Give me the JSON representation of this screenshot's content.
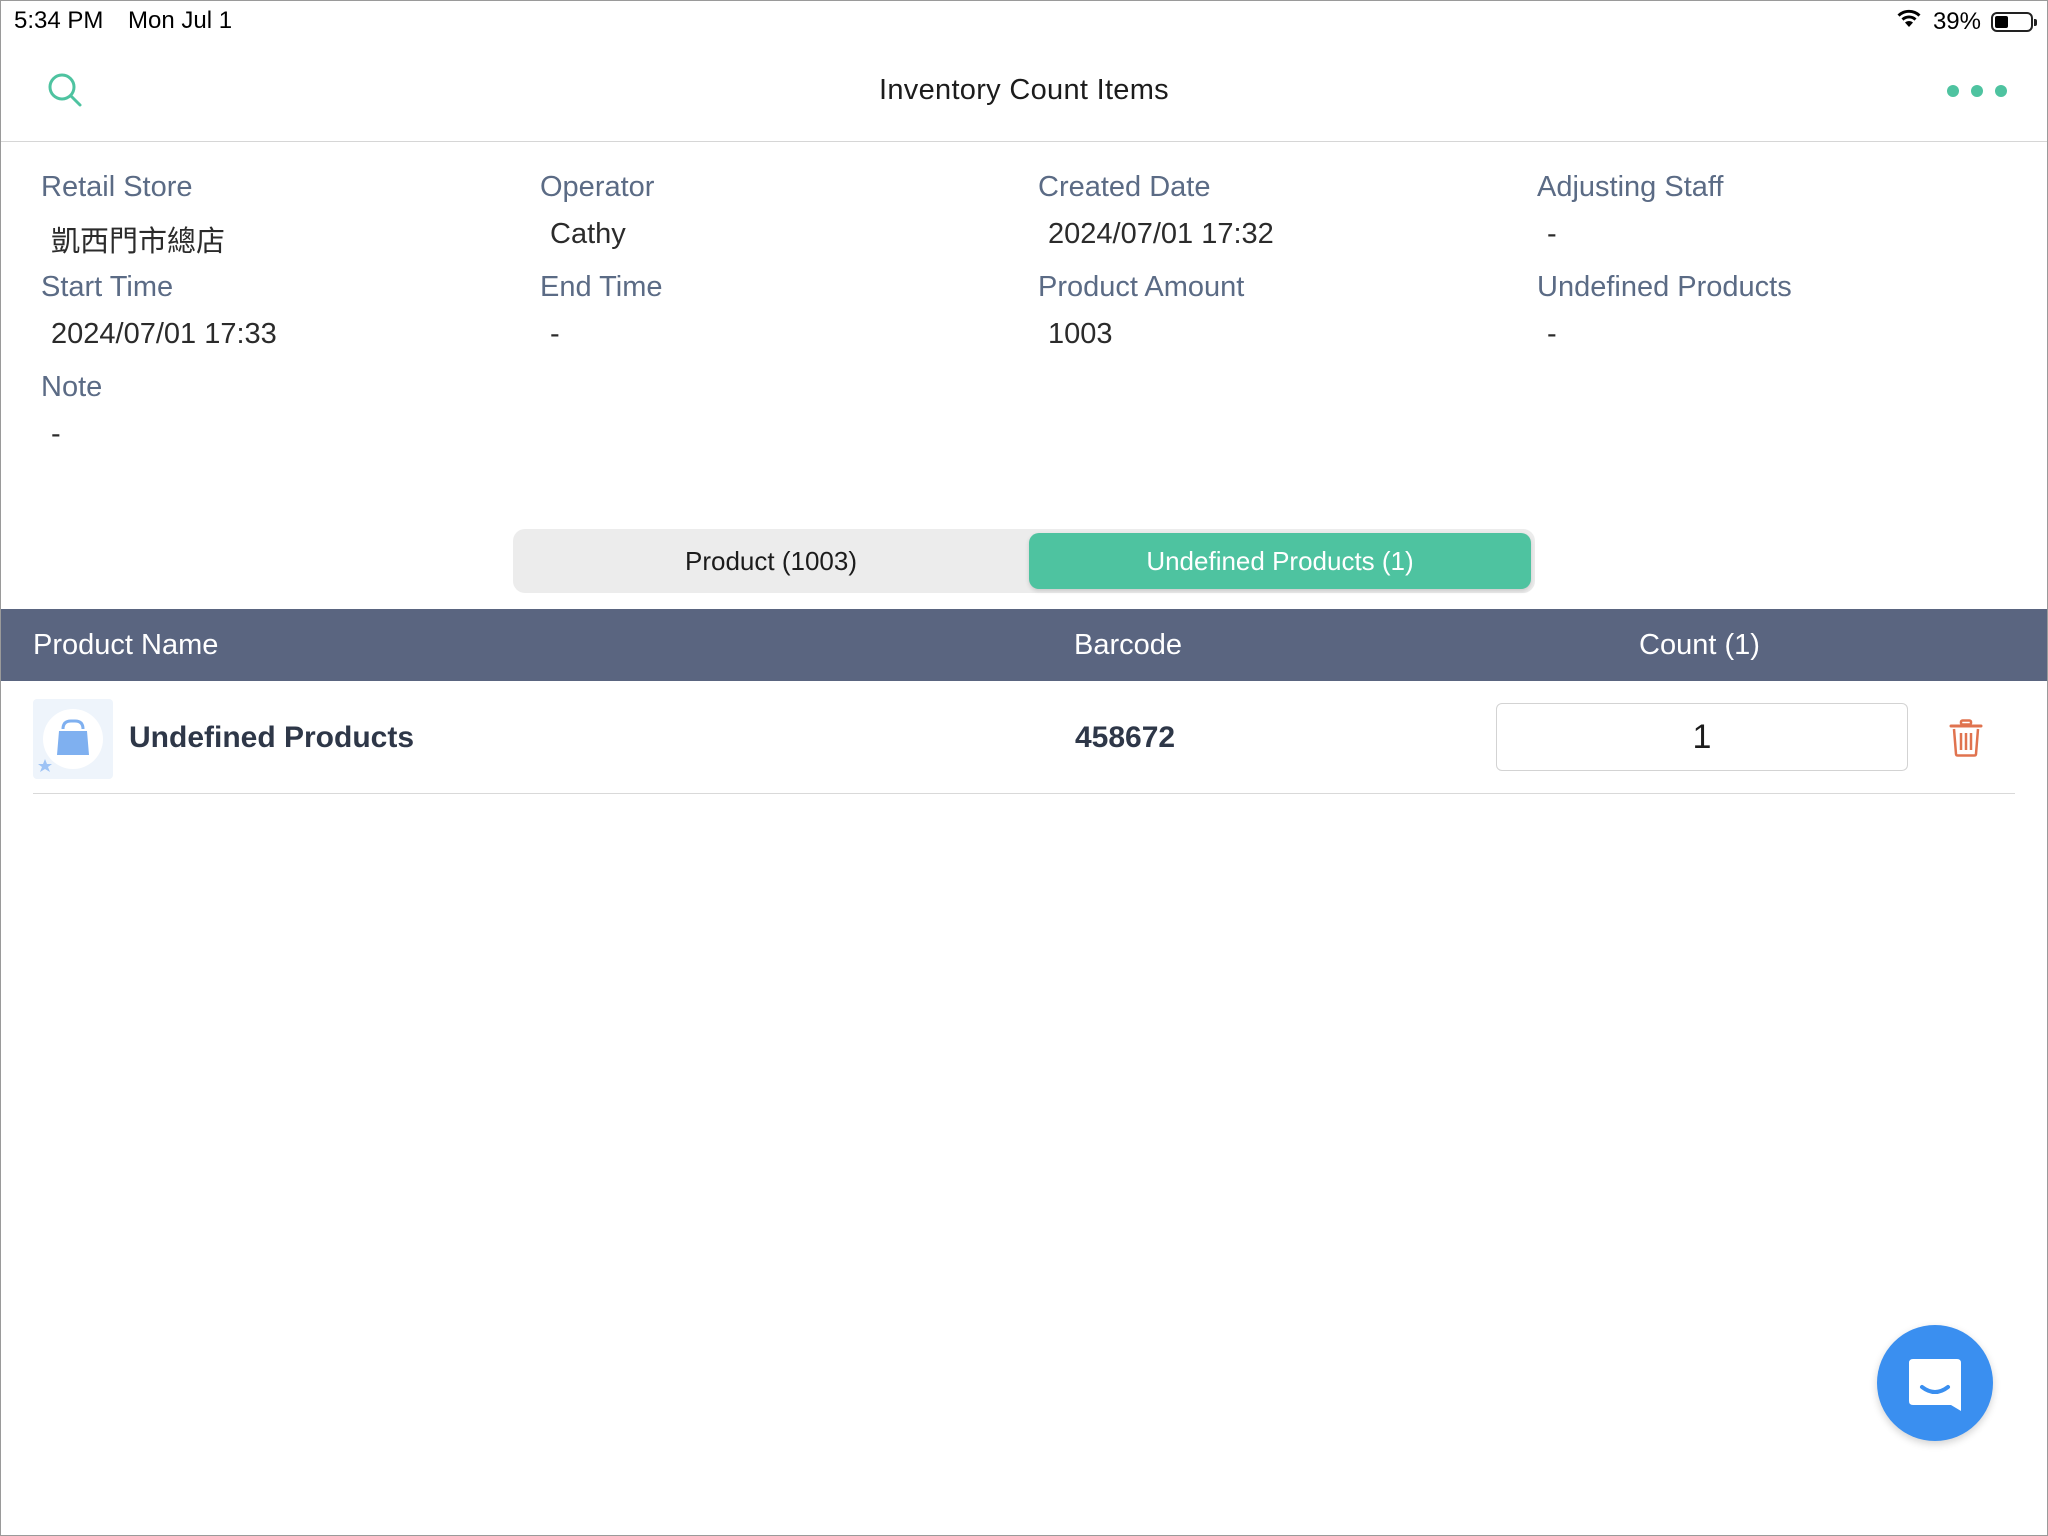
{
  "status_bar": {
    "time": "5:34 PM",
    "date": "Mon Jul 1",
    "battery": "39%",
    "battery_level": 0.39
  },
  "nav": {
    "title": "Inventory Count Items",
    "search_icon": "search-icon",
    "more_icon": "more-dots-icon"
  },
  "info": {
    "retail_store": {
      "label": "Retail Store",
      "value": "凱西門市總店"
    },
    "operator": {
      "label": "Operator",
      "value": "Cathy"
    },
    "created_date": {
      "label": "Created Date",
      "value": "2024/07/01 17:32"
    },
    "adjusting_staff": {
      "label": "Adjusting Staff",
      "value": "-"
    },
    "start_time": {
      "label": "Start Time",
      "value": "2024/07/01 17:33"
    },
    "end_time": {
      "label": "End Time",
      "value": "-"
    },
    "product_amount": {
      "label": "Product Amount",
      "value": "1003"
    },
    "undefined_products": {
      "label": "Undefined Products",
      "value": "-"
    },
    "note": {
      "label": "Note",
      "value": "-"
    }
  },
  "segments": {
    "product": "Product (1003)",
    "undefined": "Undefined Products (1)",
    "selected": "undefined"
  },
  "table": {
    "columns": {
      "name": "Product Name",
      "barcode": "Barcode",
      "count": "Count (1)"
    },
    "rows": [
      {
        "name": "Undefined Products",
        "barcode": "458672",
        "count": "1"
      }
    ]
  },
  "colors": {
    "accent": "#4ec3a0",
    "header_bg": "#5a6580",
    "label": "#5b6b85",
    "delete": "#e0734f",
    "chat": "#3a8ff0"
  }
}
